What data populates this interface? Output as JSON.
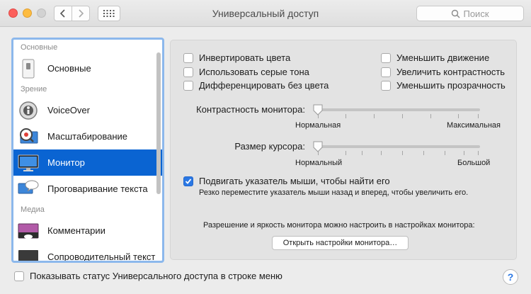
{
  "window": {
    "title": "Универсальный доступ",
    "search_placeholder": "Поиск"
  },
  "sidebar": {
    "sections": [
      {
        "label": "Основные",
        "items": [
          {
            "label": "Основные",
            "icon": "switch-icon",
            "selected": false
          }
        ]
      },
      {
        "label": "Зрение",
        "items": [
          {
            "label": "VoiceOver",
            "icon": "voiceover-icon",
            "selected": false
          },
          {
            "label": "Масштабирование",
            "icon": "zoom-icon",
            "selected": false
          },
          {
            "label": "Монитор",
            "icon": "monitor-icon",
            "selected": true
          },
          {
            "label": "Проговаривание текста",
            "icon": "speech-bubble-icon",
            "selected": false
          }
        ]
      },
      {
        "label": "Медиа",
        "items": [
          {
            "label": "Комментарии",
            "icon": "descriptions-icon",
            "selected": false
          },
          {
            "label": "Сопроводительный текст",
            "icon": "captions-icon",
            "selected": false
          }
        ]
      }
    ]
  },
  "display": {
    "checkboxes_left": [
      {
        "label": "Инвертировать цвета",
        "checked": false
      },
      {
        "label": "Использовать серые тона",
        "checked": false
      },
      {
        "label": "Дифференцировать без цвета",
        "checked": false
      }
    ],
    "checkboxes_right": [
      {
        "label": "Уменьшить движение",
        "checked": false
      },
      {
        "label": "Увеличить контрастность",
        "checked": false
      },
      {
        "label": "Уменьшить прозрачность",
        "checked": false
      }
    ],
    "contrast": {
      "label": "Контрастность монитора:",
      "min_label": "Нормальная",
      "max_label": "Максимальная",
      "value": 0
    },
    "cursor": {
      "label": "Размер курсора:",
      "min_label": "Нормальный",
      "max_label": "Большой",
      "value": 0
    },
    "shake": {
      "label": "Подвигать указатель мыши, чтобы найти его",
      "checked": true,
      "description": "Резко переместите указатель мыши назад и вперед, чтобы увеличить его."
    },
    "resolution_note": "Разрешение и яркость монитора можно настроить в настройках монитора:",
    "open_button": "Открыть настройки монитора…"
  },
  "bottom": {
    "show_status_label": "Показывать статус Универсального доступа в строке меню",
    "show_status_checked": false,
    "help": "?"
  },
  "colors": {
    "accent": "#0a64d2",
    "selection_border": "#8cb8ec",
    "close": "#fc605c",
    "minimize": "#fdbc40"
  }
}
